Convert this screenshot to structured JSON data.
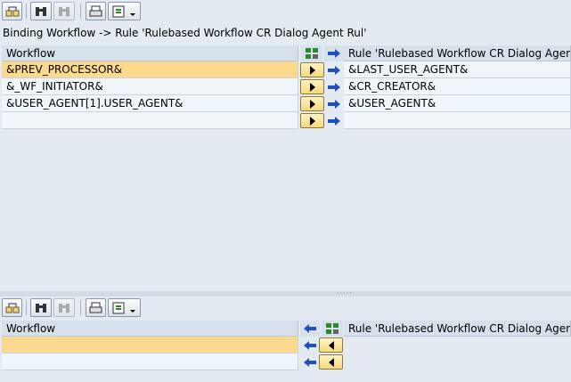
{
  "caption": "Binding Workflow  -> Rule 'Rulebased Workflow CR Dialog Agent Rul'",
  "top_grid": {
    "left_header": "Workflow",
    "right_header": "Rule 'Rulebased Workflow CR Dialog Agent",
    "rows": [
      {
        "left": "&PREV_PROCESSOR&",
        "right": "&LAST_USER_AGENT&"
      },
      {
        "left": "&_WF_INITIATOR&",
        "right": "&CR_CREATOR&"
      },
      {
        "left": "&USER_AGENT[1].USER_AGENT&",
        "right": "&USER_AGENT&"
      },
      {
        "left": "",
        "right": ""
      }
    ]
  },
  "bottom_grid": {
    "left_header": "Workflow",
    "right_header": "Rule 'Rulebased Workflow CR Dialog Agent",
    "rows": [
      {
        "left": ""
      },
      {
        "left": ""
      }
    ]
  },
  "colors": {
    "selection": "#fbd98e",
    "arrow_blue": "#1f4fbf"
  }
}
